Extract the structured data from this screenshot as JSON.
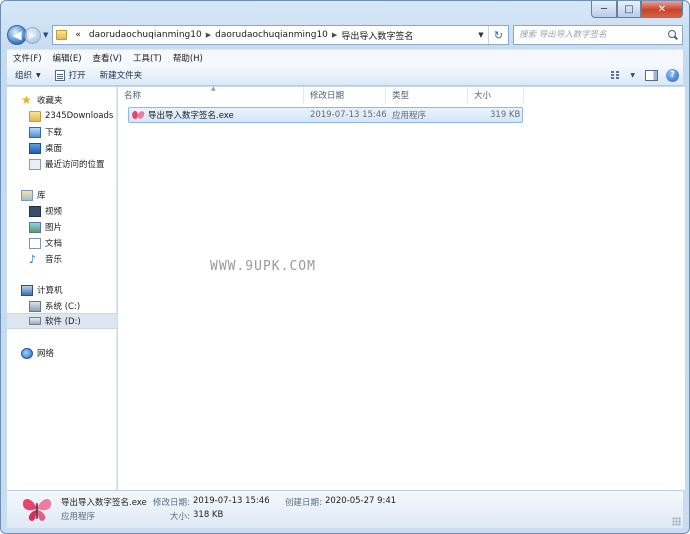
{
  "window": {
    "caption_min": "─",
    "caption_max": "□",
    "caption_close": "✕"
  },
  "address": {
    "overflow": "«",
    "crumbs": [
      "daorudaochuqianming10",
      "daorudaochuqianming10",
      "导出导入数字签名"
    ],
    "search_placeholder": "搜索 导出导入数字签名"
  },
  "menu": [
    "文件(F)",
    "编辑(E)",
    "查看(V)",
    "工具(T)",
    "帮助(H)"
  ],
  "toolbar": {
    "organize": "组织",
    "open": "打开",
    "new_folder": "新建文件夹"
  },
  "nav": {
    "favorites": "收藏夹",
    "favorites_items": [
      "2345Downloads",
      "下载",
      "桌面",
      "最近访问的位置"
    ],
    "libraries": "库",
    "library_items": [
      "视频",
      "图片",
      "文档",
      "音乐"
    ],
    "computer": "计算机",
    "drives": [
      "系统 (C:)",
      "软件 (D:)"
    ],
    "network": "网络"
  },
  "list": {
    "columns": [
      "名称",
      "修改日期",
      "类型",
      "大小"
    ],
    "rows": [
      {
        "name": "导出导入数字签名.exe",
        "modified": "2019-07-13 15:46",
        "type": "应用程序",
        "size": "319 KB"
      }
    ],
    "watermark": "WWW.9UPK.COM"
  },
  "details": {
    "filename": "导出导入数字签名.exe",
    "modified_label": "修改日期:",
    "modified": "2019-07-13 15:46",
    "created_label": "创建日期:",
    "created": "2020-05-27 9:41",
    "type": "应用程序",
    "size_label": "大小:",
    "size": "318 KB"
  },
  "colors": {
    "accent": "#3f7fc8",
    "selection": "#d3e6fb",
    "close": "#c8432f"
  }
}
